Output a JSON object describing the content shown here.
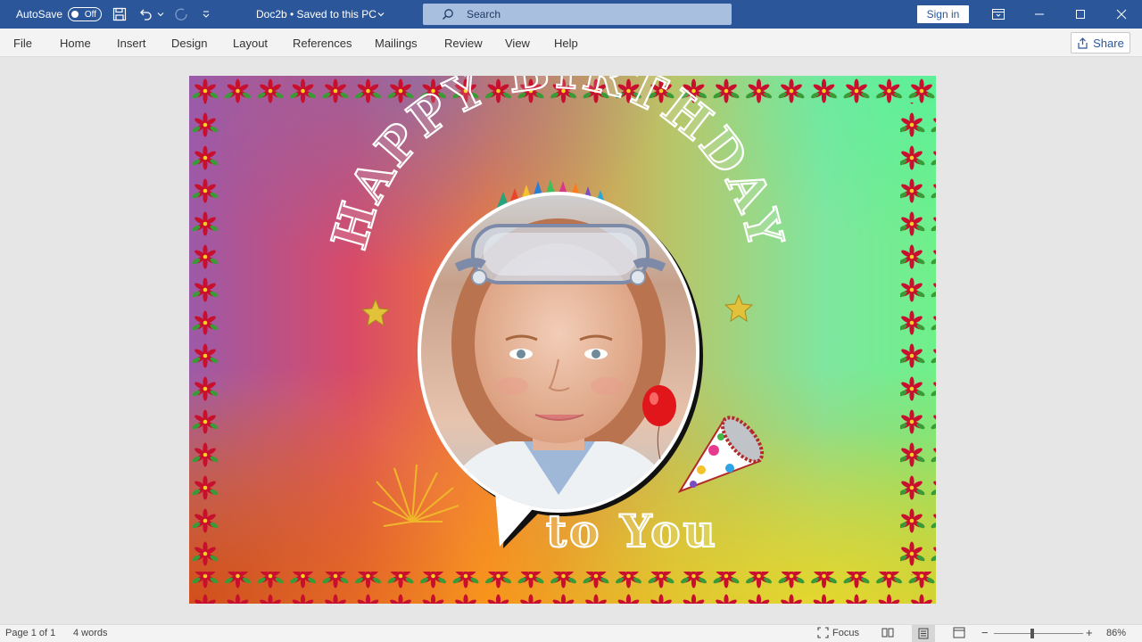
{
  "titlebar": {
    "autosave_label": "AutoSave",
    "autosave_state": "Off",
    "doc_title": "Doc2b • Saved to this PC",
    "search_placeholder": "Search",
    "sign_in": "Sign in"
  },
  "menu": {
    "tabs": [
      "File",
      "Home",
      "Insert",
      "Design",
      "Layout",
      "References",
      "Mailings",
      "Review",
      "View",
      "Help"
    ],
    "share": "Share"
  },
  "card": {
    "headline": "HAPPY BIRTHDAY",
    "tagline": "to You"
  },
  "status": {
    "page": "Page 1 of 1",
    "words": "4 words",
    "focus": "Focus",
    "zoom": "86%"
  },
  "colors": {
    "title_bar": "#2b579a",
    "accent": "#2b579a"
  }
}
